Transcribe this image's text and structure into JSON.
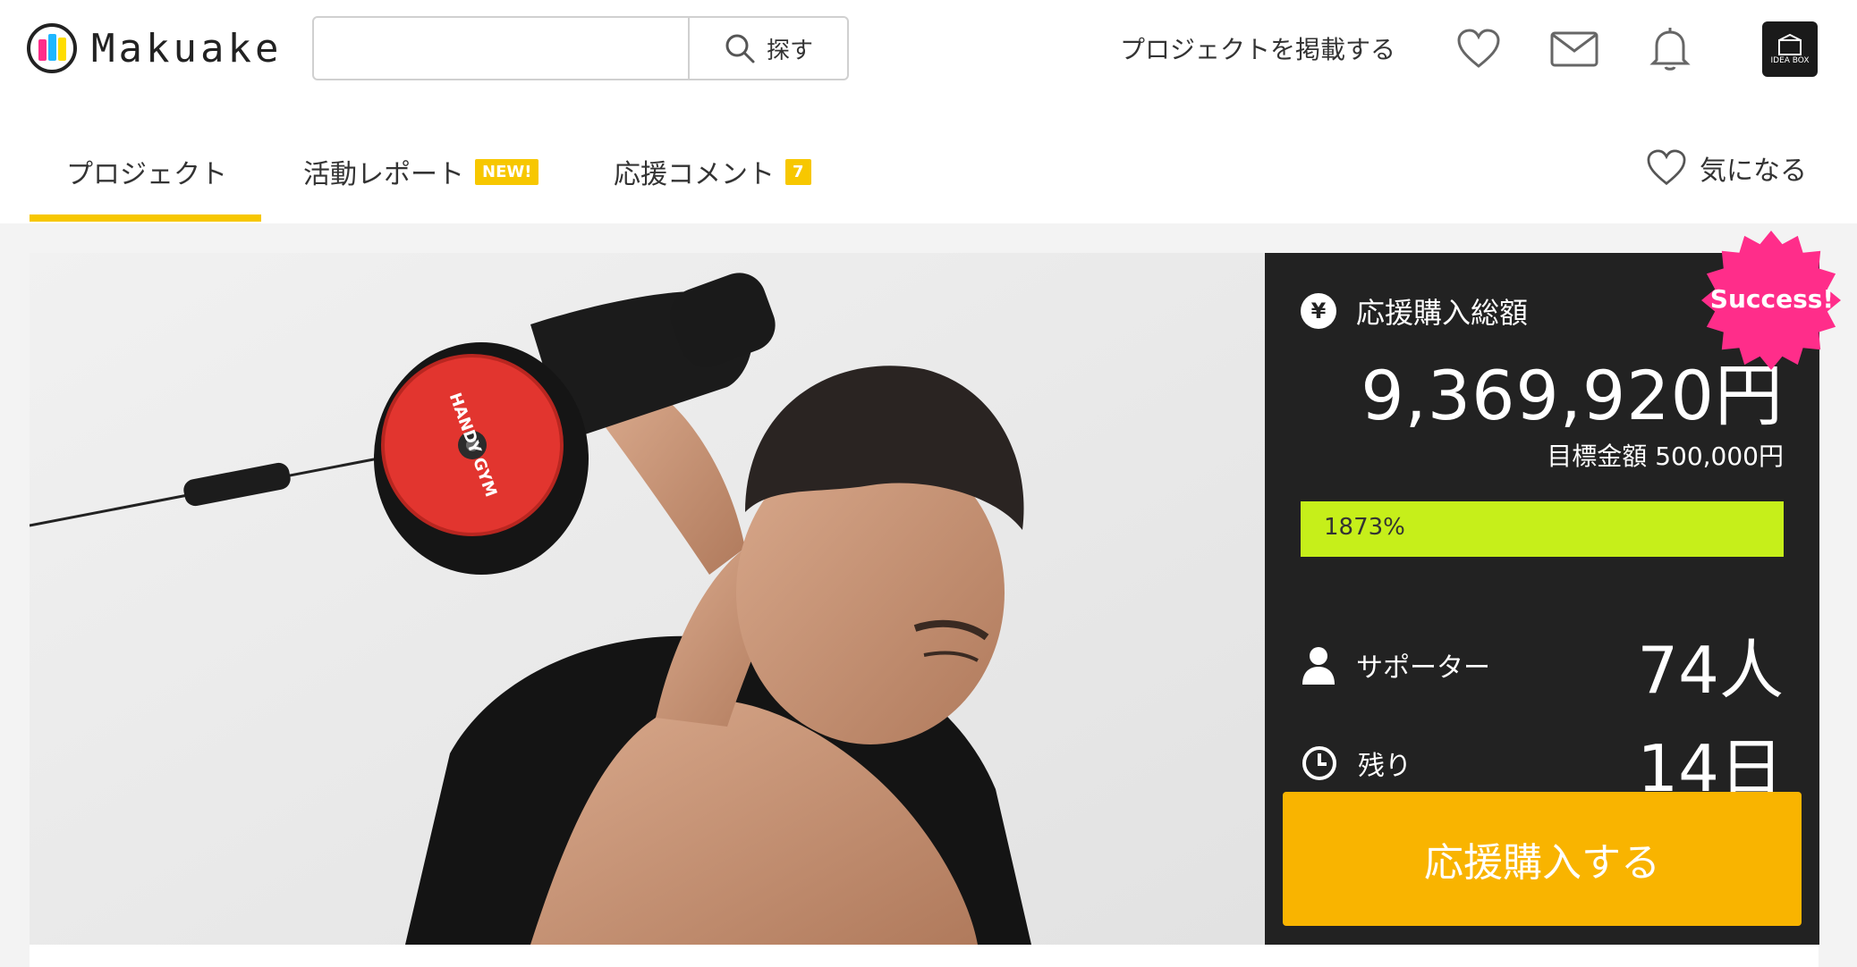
{
  "header": {
    "logo_text": "Makuake",
    "search": {
      "placeholder": "",
      "button_label": "探す"
    },
    "post_link": "プロジェクトを掲載する",
    "avatar_lines": [
      "IDEA BOX"
    ]
  },
  "tabs": {
    "items": [
      {
        "label": "プロジェクト",
        "active": true
      },
      {
        "label": "活動レポート",
        "badge": "NEW!"
      },
      {
        "label": "応援コメント",
        "badge": "7"
      }
    ],
    "favorite_label": "気になる"
  },
  "hero": {
    "product_text": "HANDY GYM"
  },
  "funding": {
    "total_label": "応援購入総額",
    "total_amount": "9,369,920円",
    "target": "目標金額 500,000円",
    "progress_percent_text": "1873%",
    "progress_fill": 1.0,
    "supporters_label": "サポーター",
    "supporters_value": "74人",
    "remaining_label": "残り",
    "remaining_value": "14日",
    "cta_label": "応援購入する",
    "success_badge": "Success!",
    "yen_symbol": "¥"
  },
  "colors": {
    "accent_yellow": "#f7c700",
    "cta": "#f9b400",
    "progress": "#c6ef1a",
    "panel_bg": "#222222",
    "success_pink": "#ff2d8a"
  }
}
